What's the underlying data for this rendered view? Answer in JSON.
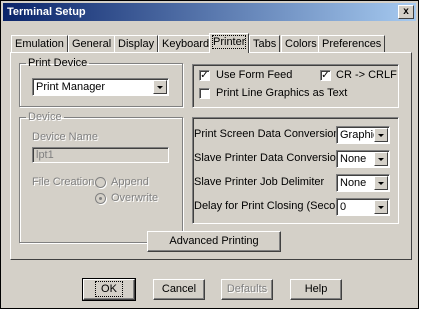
{
  "window": {
    "title": "Terminal Setup",
    "close_glyph": "x"
  },
  "tabs": [
    "Emulation",
    "General",
    "Display",
    "Keyboard",
    "Printer",
    "Tabs",
    "Colors",
    "Preferences"
  ],
  "active_tab": "Printer",
  "print_device": {
    "legend": "Print Device",
    "selected": "Print Manager"
  },
  "options": {
    "use_form_feed": {
      "label": "Use Form Feed",
      "checked": true
    },
    "cr_crlf": {
      "label": "CR -> CRLF",
      "checked": true
    },
    "print_line_graphics": {
      "label": "Print Line Graphics as Text",
      "checked": false
    },
    "check_glyph": "✓"
  },
  "device": {
    "legend": "Device",
    "name_label": "Device Name",
    "name_value": "lpt1",
    "file_creation_label": "File Creation",
    "append_label": "Append",
    "overwrite_label": "Overwrite",
    "selected": "Overwrite"
  },
  "conversion": {
    "print_screen": {
      "label": "Print Screen Data Conversion",
      "value": "Graphics"
    },
    "slave_data": {
      "label": "Slave Printer Data Conversion",
      "value": "None"
    },
    "slave_delimiter": {
      "label": "Slave Printer Job Delimiter",
      "value": "None"
    },
    "delay": {
      "label": "Delay for Print Closing (Seconds)",
      "value": "0"
    }
  },
  "buttons": {
    "advanced": "Advanced Printing",
    "ok": "OK",
    "cancel": "Cancel",
    "defaults": "Defaults",
    "help": "Help"
  },
  "colors": {
    "title_start": "#0a246a",
    "title_end": "#a6caf0",
    "face": "#d4d0c8"
  }
}
